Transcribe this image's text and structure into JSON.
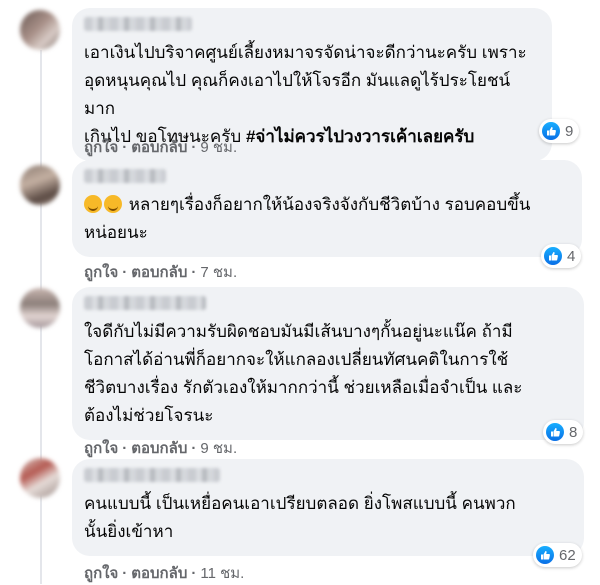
{
  "colors": {
    "bubble": "#f0f2f5",
    "like": "#1877f2",
    "meta": "#65676b"
  },
  "icons": {
    "reaction": "like-icon"
  },
  "comments": [
    {
      "text": "เอาเงินไปบริจาคศูนย์เลี้ยงหมาจรจัดน่าจะดีกว่านะครับ เพราะ\nอุดหนุนคุณไป คุณก็คงเอาไปให้โจรอีก มันแลดูไร้ประโยชน์มาก\nเกินไป ขอโทษนะครับ ",
      "hashtag": "#จ่าไม่ควรไปวงวารเค้าเลยครับ",
      "like_label": "ถูกใจ",
      "reply_label": "ตอบกลับ",
      "time": "9 ชม.",
      "reactions": "9"
    },
    {
      "text": " หลายๆเรื่องก็อยากให้น้องจริงจังกับชีวิตบ้าง รอบคอบขึ้น\nหน่อยนะ",
      "like_label": "ถูกใจ",
      "reply_label": "ตอบกลับ",
      "time": "7 ชม.",
      "reactions": "4"
    },
    {
      "text": "ใจดีกับไม่มีความรับผิดชอบมันมีเส้นบางๆกั้นอยู่นะแน๊ค ถ้ามี\nโอกาสได้อ่านพี่ก็อยากจะให้แกลองเปลี่ยนทัศนคติในการใช้\nชีวิตบางเรื่อง รักตัวเองให้มากกว่านี้ ช่วยเหลือเมื่อจำเป็น และ\nต้องไม่ช่วยโจรนะ",
      "like_label": "ถูกใจ",
      "reply_label": "ตอบกลับ",
      "time": "9 ชม.",
      "reactions": "8"
    },
    {
      "text": "คนแบบนี้ เป็นเหยื่อคนเอาเปรียบตลอด ยิ่งโพสแบบนี้ คนพวก\nนั้นยิ่งเข้าหา",
      "like_label": "ถูกใจ",
      "reply_label": "ตอบกลับ",
      "time": "11 ชม.",
      "reactions": "62"
    }
  ]
}
